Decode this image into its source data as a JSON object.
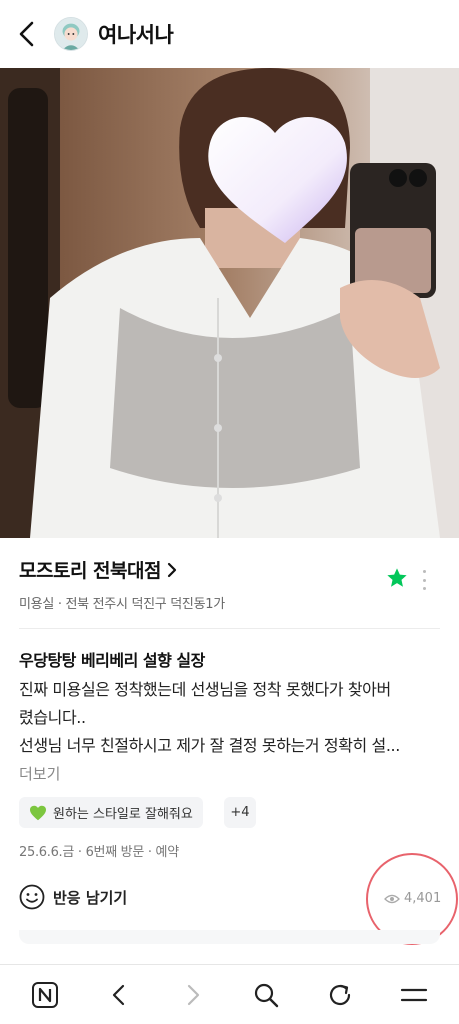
{
  "header": {
    "title": "여나서나",
    "back_icon": "chevron-left-icon",
    "avatar_icon": "profile-avatar"
  },
  "photo": {
    "description_icon": "post-photo"
  },
  "place": {
    "name": "모즈토리 전북대점",
    "category": "미용실",
    "address": "전북 전주시 덕진구 덕진동1가",
    "favorite_color": "#03c75a"
  },
  "review": {
    "title": "우당탕탕 베리베리 설향 실장",
    "lines": [
      "진짜 미용실은 정착했는데 선생님을 정착 못했다가 찾아버",
      "렸습니다..",
      "선생님 너무 친절하시고 제가 잘 결정 못하는거 정확히 설..."
    ],
    "more_label": "더보기"
  },
  "tags": {
    "first": "원하는 스타일로 잘해줘요",
    "count": "+4",
    "heart_color": "#7cc63f"
  },
  "visit": {
    "date": "25.6.6.금",
    "visit_count": "6번째 방문",
    "type": "예약"
  },
  "reaction": {
    "label": "반응 남기기",
    "views": "4,401"
  },
  "bottom_nav": {
    "items": [
      "naver-home-icon",
      "back-icon",
      "forward-icon",
      "search-icon",
      "refresh-icon",
      "menu-icon"
    ]
  }
}
